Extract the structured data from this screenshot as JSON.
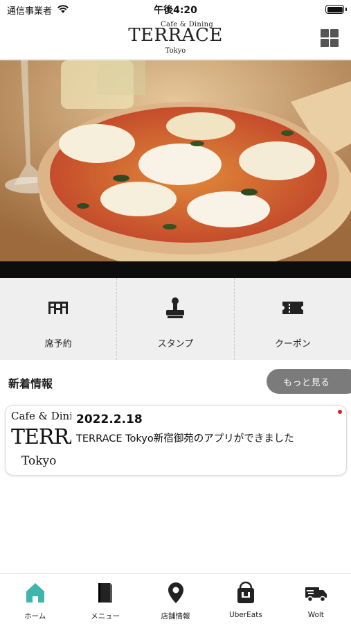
{
  "status_bar": {
    "carrier": "通信事業者",
    "time": "午後4:20"
  },
  "header": {
    "logo_sub": "Cafe & Dining",
    "logo_main": "TERRACE",
    "logo_city": "Tokyo"
  },
  "hero": {
    "image": "pizza-photo"
  },
  "quick_menu": [
    {
      "label": "席予約",
      "icon": "table-reservation-icon"
    },
    {
      "label": "スタンプ",
      "icon": "stamp-icon"
    },
    {
      "label": "クーポン",
      "icon": "coupon-icon"
    }
  ],
  "news": {
    "title": "新着情報",
    "more_label": "もっと見る",
    "items": [
      {
        "thumb_sub": "Cafe & Dining",
        "thumb_main": "TERRACE",
        "thumb_city": "Tokyo",
        "date": "2022.2.18",
        "text": "TERRACE Tokyo新宿御苑のアプリができました",
        "unread": true
      }
    ]
  },
  "tabs": [
    {
      "label": "ホーム",
      "icon": "home-icon",
      "active": true
    },
    {
      "label": "メニュー",
      "icon": "menu-book-icon",
      "active": false
    },
    {
      "label": "店舗情報",
      "icon": "location-pin-icon",
      "active": false
    },
    {
      "label": "UberEats",
      "icon": "ubereats-bag-icon",
      "active": false
    },
    {
      "label": "Wolt",
      "icon": "delivery-truck-icon",
      "active": false
    }
  ],
  "colors": {
    "accent": "#3fb5ad",
    "more_button": "#7b7b7b",
    "quick_menu_bg": "#efefef",
    "unread": "#e02020"
  }
}
